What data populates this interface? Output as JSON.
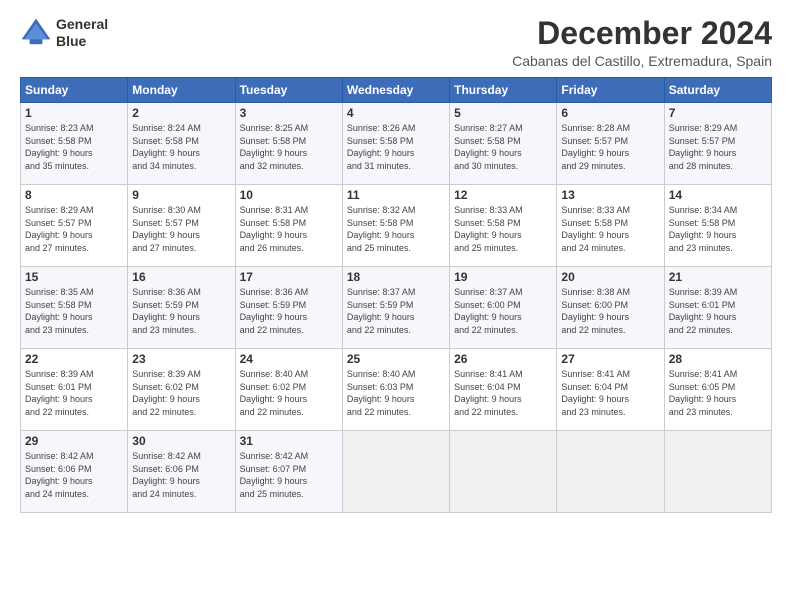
{
  "logo": {
    "line1": "General",
    "line2": "Blue"
  },
  "title": "December 2024",
  "location": "Cabanas del Castillo, Extremadura, Spain",
  "days_of_week": [
    "Sunday",
    "Monday",
    "Tuesday",
    "Wednesday",
    "Thursday",
    "Friday",
    "Saturday"
  ],
  "weeks": [
    [
      {
        "day": "1",
        "text": "Sunrise: 8:23 AM\nSunset: 5:58 PM\nDaylight: 9 hours\nand 35 minutes."
      },
      {
        "day": "2",
        "text": "Sunrise: 8:24 AM\nSunset: 5:58 PM\nDaylight: 9 hours\nand 34 minutes."
      },
      {
        "day": "3",
        "text": "Sunrise: 8:25 AM\nSunset: 5:58 PM\nDaylight: 9 hours\nand 32 minutes."
      },
      {
        "day": "4",
        "text": "Sunrise: 8:26 AM\nSunset: 5:58 PM\nDaylight: 9 hours\nand 31 minutes."
      },
      {
        "day": "5",
        "text": "Sunrise: 8:27 AM\nSunset: 5:58 PM\nDaylight: 9 hours\nand 30 minutes."
      },
      {
        "day": "6",
        "text": "Sunrise: 8:28 AM\nSunset: 5:57 PM\nDaylight: 9 hours\nand 29 minutes."
      },
      {
        "day": "7",
        "text": "Sunrise: 8:29 AM\nSunset: 5:57 PM\nDaylight: 9 hours\nand 28 minutes."
      }
    ],
    [
      {
        "day": "8",
        "text": "Sunrise: 8:29 AM\nSunset: 5:57 PM\nDaylight: 9 hours\nand 27 minutes."
      },
      {
        "day": "9",
        "text": "Sunrise: 8:30 AM\nSunset: 5:57 PM\nDaylight: 9 hours\nand 27 minutes."
      },
      {
        "day": "10",
        "text": "Sunrise: 8:31 AM\nSunset: 5:58 PM\nDaylight: 9 hours\nand 26 minutes."
      },
      {
        "day": "11",
        "text": "Sunrise: 8:32 AM\nSunset: 5:58 PM\nDaylight: 9 hours\nand 25 minutes."
      },
      {
        "day": "12",
        "text": "Sunrise: 8:33 AM\nSunset: 5:58 PM\nDaylight: 9 hours\nand 25 minutes."
      },
      {
        "day": "13",
        "text": "Sunrise: 8:33 AM\nSunset: 5:58 PM\nDaylight: 9 hours\nand 24 minutes."
      },
      {
        "day": "14",
        "text": "Sunrise: 8:34 AM\nSunset: 5:58 PM\nDaylight: 9 hours\nand 23 minutes."
      }
    ],
    [
      {
        "day": "15",
        "text": "Sunrise: 8:35 AM\nSunset: 5:58 PM\nDaylight: 9 hours\nand 23 minutes."
      },
      {
        "day": "16",
        "text": "Sunrise: 8:36 AM\nSunset: 5:59 PM\nDaylight: 9 hours\nand 23 minutes."
      },
      {
        "day": "17",
        "text": "Sunrise: 8:36 AM\nSunset: 5:59 PM\nDaylight: 9 hours\nand 22 minutes."
      },
      {
        "day": "18",
        "text": "Sunrise: 8:37 AM\nSunset: 5:59 PM\nDaylight: 9 hours\nand 22 minutes."
      },
      {
        "day": "19",
        "text": "Sunrise: 8:37 AM\nSunset: 6:00 PM\nDaylight: 9 hours\nand 22 minutes."
      },
      {
        "day": "20",
        "text": "Sunrise: 8:38 AM\nSunset: 6:00 PM\nDaylight: 9 hours\nand 22 minutes."
      },
      {
        "day": "21",
        "text": "Sunrise: 8:39 AM\nSunset: 6:01 PM\nDaylight: 9 hours\nand 22 minutes."
      }
    ],
    [
      {
        "day": "22",
        "text": "Sunrise: 8:39 AM\nSunset: 6:01 PM\nDaylight: 9 hours\nand 22 minutes."
      },
      {
        "day": "23",
        "text": "Sunrise: 8:39 AM\nSunset: 6:02 PM\nDaylight: 9 hours\nand 22 minutes."
      },
      {
        "day": "24",
        "text": "Sunrise: 8:40 AM\nSunset: 6:02 PM\nDaylight: 9 hours\nand 22 minutes."
      },
      {
        "day": "25",
        "text": "Sunrise: 8:40 AM\nSunset: 6:03 PM\nDaylight: 9 hours\nand 22 minutes."
      },
      {
        "day": "26",
        "text": "Sunrise: 8:41 AM\nSunset: 6:04 PM\nDaylight: 9 hours\nand 22 minutes."
      },
      {
        "day": "27",
        "text": "Sunrise: 8:41 AM\nSunset: 6:04 PM\nDaylight: 9 hours\nand 23 minutes."
      },
      {
        "day": "28",
        "text": "Sunrise: 8:41 AM\nSunset: 6:05 PM\nDaylight: 9 hours\nand 23 minutes."
      }
    ],
    [
      {
        "day": "29",
        "text": "Sunrise: 8:42 AM\nSunset: 6:06 PM\nDaylight: 9 hours\nand 24 minutes."
      },
      {
        "day": "30",
        "text": "Sunrise: 8:42 AM\nSunset: 6:06 PM\nDaylight: 9 hours\nand 24 minutes."
      },
      {
        "day": "31",
        "text": "Sunrise: 8:42 AM\nSunset: 6:07 PM\nDaylight: 9 hours\nand 25 minutes."
      },
      {
        "day": "",
        "text": ""
      },
      {
        "day": "",
        "text": ""
      },
      {
        "day": "",
        "text": ""
      },
      {
        "day": "",
        "text": ""
      }
    ]
  ]
}
